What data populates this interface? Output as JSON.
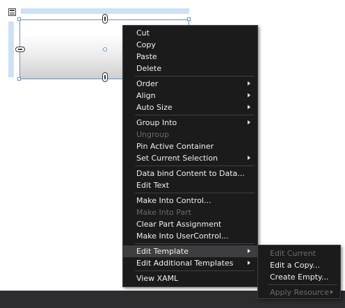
{
  "context_menu": {
    "groups": [
      [
        {
          "label": "Cut",
          "disabled": false,
          "submenu": false
        },
        {
          "label": "Copy",
          "disabled": false,
          "submenu": false
        },
        {
          "label": "Paste",
          "disabled": false,
          "submenu": false
        },
        {
          "label": "Delete",
          "disabled": false,
          "submenu": false
        }
      ],
      [
        {
          "label": "Order",
          "disabled": false,
          "submenu": true
        },
        {
          "label": "Align",
          "disabled": false,
          "submenu": true
        },
        {
          "label": "Auto Size",
          "disabled": false,
          "submenu": true
        }
      ],
      [
        {
          "label": "Group Into",
          "disabled": false,
          "submenu": true
        },
        {
          "label": "Ungroup",
          "disabled": true,
          "submenu": false
        },
        {
          "label": "Pin Active Container",
          "disabled": false,
          "submenu": false
        },
        {
          "label": "Set Current Selection",
          "disabled": false,
          "submenu": true
        }
      ],
      [
        {
          "label": "Data bind Content to Data...",
          "disabled": false,
          "submenu": false
        },
        {
          "label": "Edit Text",
          "disabled": false,
          "submenu": false
        }
      ],
      [
        {
          "label": "Make Into Control...",
          "disabled": false,
          "submenu": false
        },
        {
          "label": "Make Into Part",
          "disabled": true,
          "submenu": false
        },
        {
          "label": "Clear Part Assignment",
          "disabled": false,
          "submenu": false
        },
        {
          "label": "Make Into UserControl...",
          "disabled": false,
          "submenu": false
        }
      ],
      [
        {
          "label": "Edit Template",
          "disabled": false,
          "submenu": true,
          "highlighted": true
        },
        {
          "label": "Edit Additional Templates",
          "disabled": false,
          "submenu": true
        }
      ],
      [
        {
          "label": "View XAML",
          "disabled": false,
          "submenu": false
        }
      ]
    ]
  },
  "edit_template_submenu": {
    "groups": [
      [
        {
          "label": "Edit Current",
          "disabled": true,
          "submenu": false
        },
        {
          "label": "Edit a Copy...",
          "disabled": false,
          "submenu": false
        },
        {
          "label": "Create Empty...",
          "disabled": false,
          "submenu": false
        }
      ],
      [
        {
          "label": "Apply Resource",
          "disabled": true,
          "submenu": true
        }
      ]
    ]
  },
  "colors": {
    "menu_background": "#1b1b1c",
    "menu_text": "#f1f1f1",
    "menu_disabled_text": "#6b6b6b",
    "menu_highlight": "#3e3e40",
    "selection_adorner": "#cfe0f5"
  }
}
